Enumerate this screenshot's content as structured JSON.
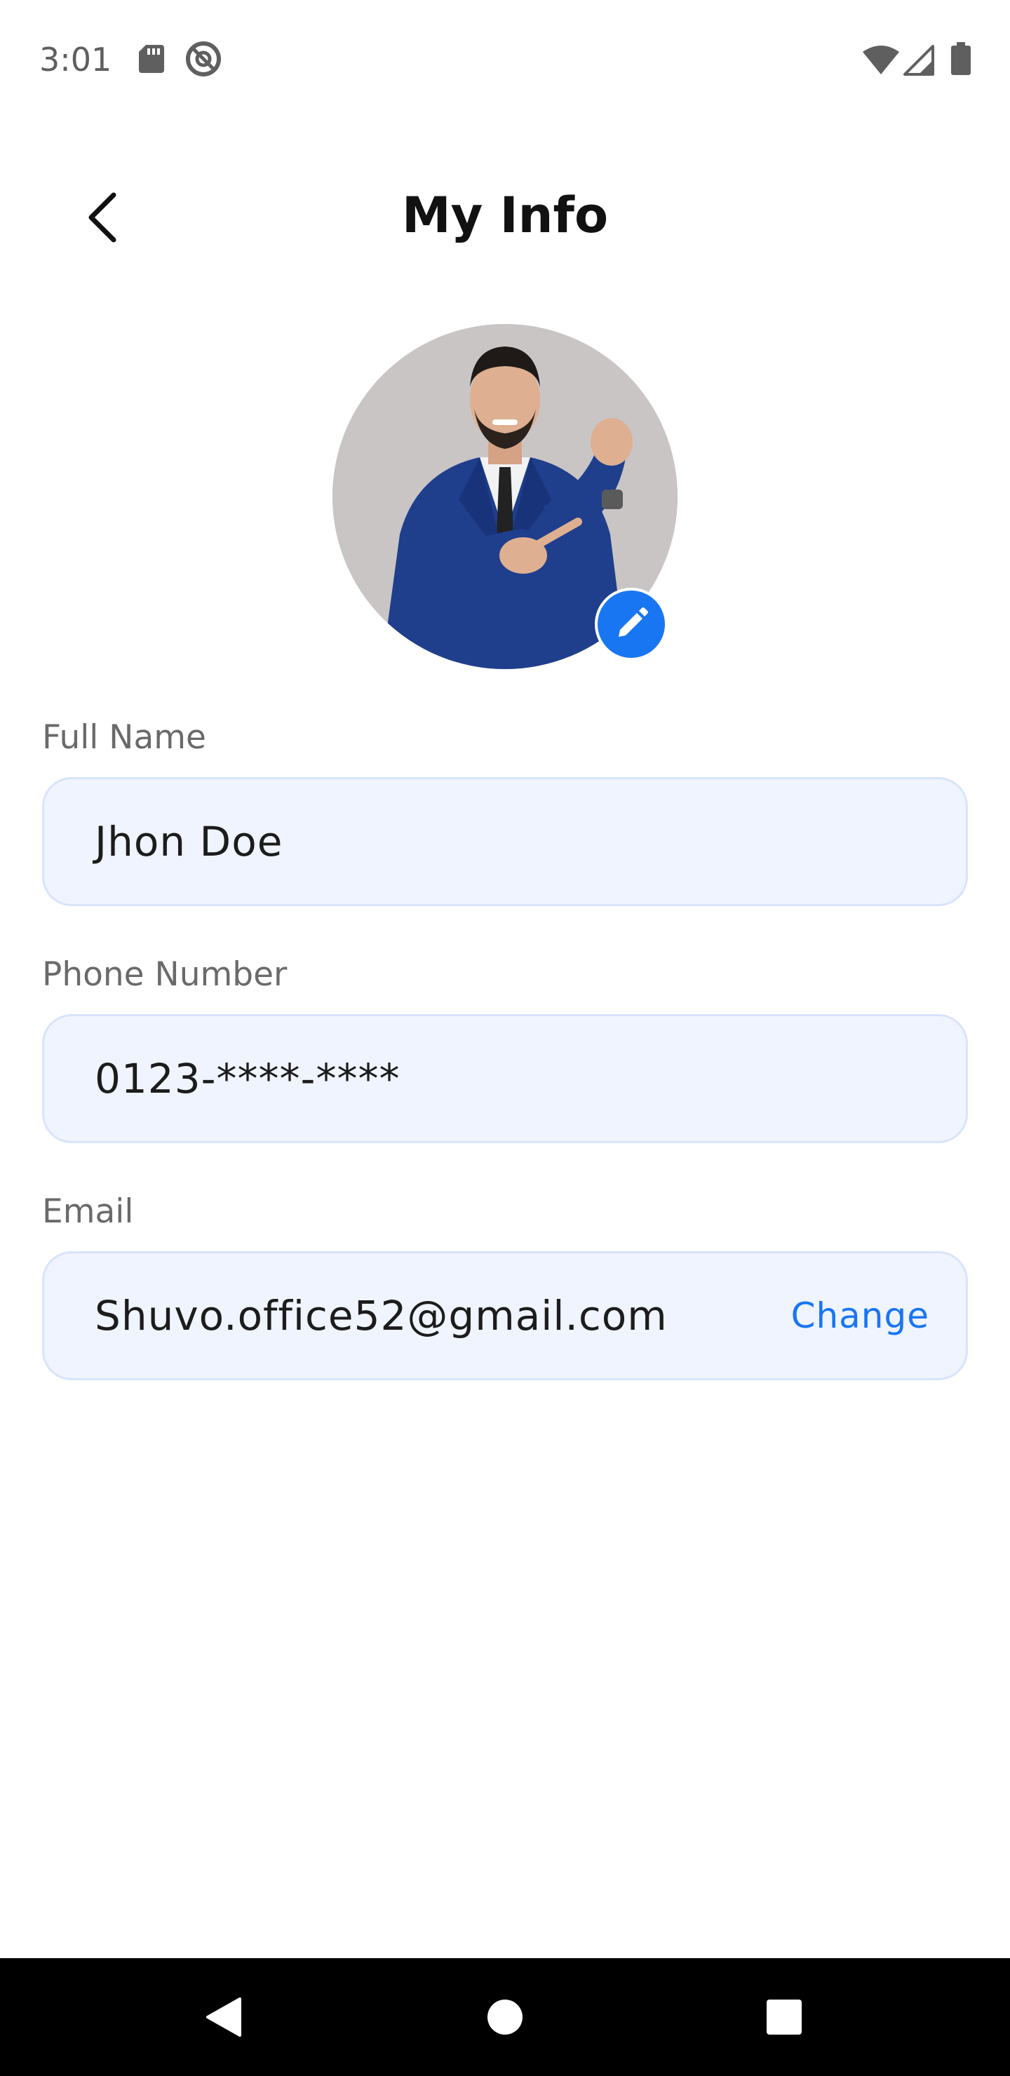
{
  "status_bar": {
    "time": "3:01",
    "icons": [
      "sd-card-icon",
      "do-not-disturb-icon",
      "wifi-icon",
      "cell-signal-icon",
      "battery-icon"
    ]
  },
  "header": {
    "title": "My Info",
    "back_icon": "chevron-left-icon"
  },
  "avatar": {
    "edit_icon": "pencil-icon",
    "edit_color": "#1876f2"
  },
  "form": {
    "full_name": {
      "label": "Full Name",
      "value": "Jhon Doe"
    },
    "phone": {
      "label": "Phone Number",
      "value": "0123-****-****"
    },
    "email": {
      "label": "Email",
      "value": "Shuvo.office52@gmail.com",
      "action": "Change"
    }
  },
  "colors": {
    "accent": "#1876f2",
    "field_bg": "#eff4fe",
    "field_border": "#d8e4fb"
  },
  "nav_bar": {
    "icons": [
      "back-triangle-icon",
      "home-circle-icon",
      "recents-square-icon"
    ]
  }
}
